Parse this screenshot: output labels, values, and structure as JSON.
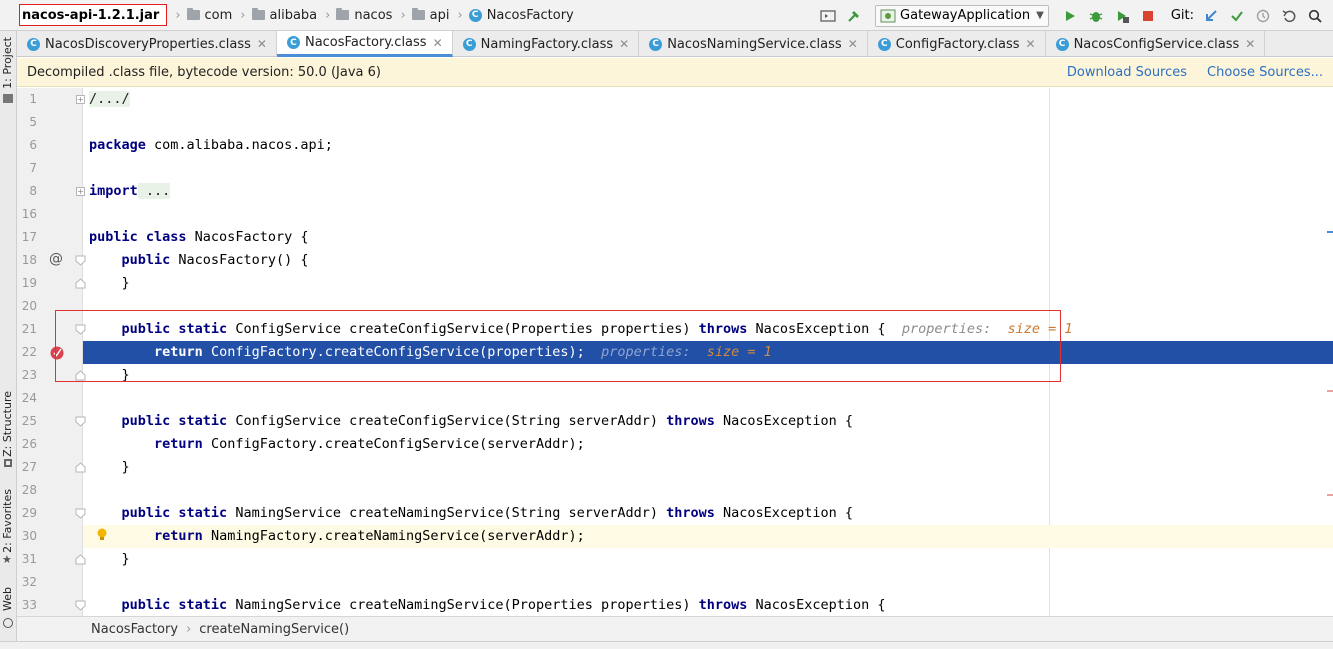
{
  "breadcrumb": {
    "jar": "nacos-api-1.2.1.jar",
    "packages": [
      "com",
      "alibaba",
      "nacos",
      "api"
    ],
    "class_name": "NacosFactory",
    "class_badge": "C"
  },
  "toolbar": {
    "run_configuration": "GatewayApplication",
    "git_label": "Git:",
    "icons": [
      "build-icon",
      "hammer-icon",
      "run-icon",
      "debug-icon",
      "coverage-icon",
      "stop-icon",
      "git-update-icon",
      "git-commit-icon",
      "git-history-icon",
      "git-rollback-icon",
      "search-icon"
    ],
    "colors": {
      "run": "#3c9a3c",
      "stop": "#d9432f",
      "git": "#3d86d1"
    }
  },
  "side_panels": {
    "project": "1: Project",
    "structure": "Z: Structure",
    "favorites": "2: Favorites",
    "web": "Web"
  },
  "tabs": [
    {
      "label": "NacosDiscoveryProperties.class",
      "active": false
    },
    {
      "label": "NacosFactory.class",
      "active": true
    },
    {
      "label": "NamingFactory.class",
      "active": false
    },
    {
      "label": "NacosNamingService.class",
      "active": false
    },
    {
      "label": "ConfigFactory.class",
      "active": false
    },
    {
      "label": "NacosConfigService.class",
      "active": false
    }
  ],
  "banner": {
    "message": "Decompiled .class file, bytecode version: 50.0 (Java 6)",
    "download_sources": "Download Sources",
    "choose_sources": "Choose Sources..."
  },
  "editor": {
    "lines": [
      {
        "num": "1",
        "indent": "",
        "kw": "",
        "text": "/.../",
        "folded": true
      },
      {
        "num": "5",
        "indent": "",
        "kw": "",
        "text": ""
      },
      {
        "num": "6",
        "indent": "",
        "kw": "package",
        "text": " com.alibaba.nacos.api;"
      },
      {
        "num": "7",
        "indent": "",
        "kw": "",
        "text": ""
      },
      {
        "num": "8",
        "indent": "",
        "kw": "import",
        "text": " ...",
        "folded": true
      },
      {
        "num": "16",
        "indent": "",
        "kw": "",
        "text": ""
      },
      {
        "num": "17",
        "indent": "",
        "kw": "public class",
        "text": " NacosFactory {"
      },
      {
        "num": "18",
        "indent": "    ",
        "kw": "public",
        "text": " NacosFactory() {"
      },
      {
        "num": "19",
        "indent": "    ",
        "kw": "",
        "text": "}"
      },
      {
        "num": "20",
        "indent": "",
        "kw": "",
        "text": ""
      },
      {
        "num": "21",
        "indent": "    ",
        "kw": "public static",
        "text": " ConfigService createConfigService(Properties properties) ",
        "kw2": "throws",
        "text2": " NacosException {",
        "hint": "properties:",
        "hint_val": "size = 1"
      },
      {
        "num": "22",
        "indent": "        ",
        "kw": "return",
        "text": " ConfigFactory.createConfigService(properties);",
        "hint": "properties:",
        "hint_val": "size = 1",
        "selected": true
      },
      {
        "num": "23",
        "indent": "    ",
        "kw": "",
        "text": "}"
      },
      {
        "num": "24",
        "indent": "",
        "kw": "",
        "text": ""
      },
      {
        "num": "25",
        "indent": "    ",
        "kw": "public static",
        "text": " ConfigService createConfigService(String serverAddr) ",
        "kw2": "throws",
        "text2": " NacosException {"
      },
      {
        "num": "26",
        "indent": "        ",
        "kw": "return",
        "text": " ConfigFactory.createConfigService(serverAddr);"
      },
      {
        "num": "27",
        "indent": "    ",
        "kw": "",
        "text": "}"
      },
      {
        "num": "28",
        "indent": "",
        "kw": "",
        "text": ""
      },
      {
        "num": "29",
        "indent": "    ",
        "kw": "public static",
        "text": " NamingService createNamingService(String serverAddr) ",
        "kw2": "throws",
        "text2": " NacosException {"
      },
      {
        "num": "30",
        "indent": "        ",
        "kw": "return",
        "text": " NamingFactory.createNamingService(serverAddr);",
        "caret": true
      },
      {
        "num": "31",
        "indent": "    ",
        "kw": "",
        "text": "}"
      },
      {
        "num": "32",
        "indent": "",
        "kw": "",
        "text": ""
      },
      {
        "num": "33",
        "indent": "    ",
        "kw": "public static",
        "text": " NamingService createNamingService(Properties properties) ",
        "kw2": "throws",
        "text2": " NacosException {"
      }
    ],
    "colors": {
      "keyword": "#000080",
      "selection": "#2350a7",
      "caret_line": "#fffae3",
      "hint_value": "#cc7832",
      "breakpoint": "#d9434f"
    }
  },
  "nav_breadcrumb": [
    "NacosFactory",
    "createNamingService()"
  ]
}
